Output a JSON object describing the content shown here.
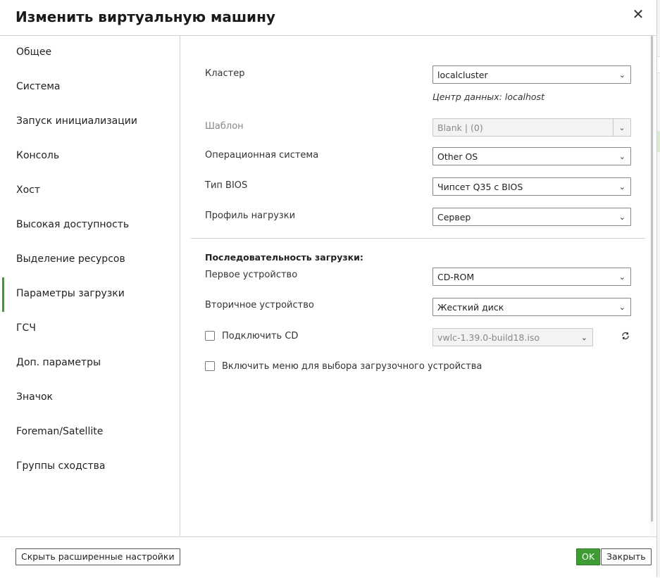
{
  "dialog": {
    "title": "Изменить виртуальную машину"
  },
  "sidebar": {
    "items": [
      {
        "label": "Общее"
      },
      {
        "label": "Система"
      },
      {
        "label": "Запуск инициализации"
      },
      {
        "label": "Консоль"
      },
      {
        "label": "Хост"
      },
      {
        "label": "Высокая доступность"
      },
      {
        "label": "Выделение ресурсов"
      },
      {
        "label": "Параметры загрузки",
        "active": true
      },
      {
        "label": "ГСЧ"
      },
      {
        "label": "Доп. параметры"
      },
      {
        "label": "Значок"
      },
      {
        "label": "Foreman/Satellite"
      },
      {
        "label": "Группы сходства"
      }
    ]
  },
  "form": {
    "cluster": {
      "label": "Кластер",
      "value": "localcluster",
      "note": "Центр данных: localhost"
    },
    "template": {
      "label": "Шаблон",
      "value": "Blank |  (0)"
    },
    "os": {
      "label": "Операционная система",
      "value": "Other OS"
    },
    "bios": {
      "label": "Тип BIOS",
      "value": "Чипсет Q35 с BIOS"
    },
    "profile": {
      "label": "Профиль нагрузки",
      "value": "Сервер"
    },
    "boot_sequence_title": "Последовательность загрузки:",
    "first_device": {
      "label": "Первое устройство",
      "value": "CD-ROM"
    },
    "second_device": {
      "label": "Вторичное устройство",
      "value": "Жесткий диск"
    },
    "attach_cd": {
      "label": "Подключить CD",
      "value": "vwlc-1.39.0-build18.iso",
      "checked": false
    },
    "boot_menu": {
      "label": "Включить меню для выбора загрузочного устройства",
      "checked": false
    }
  },
  "footer": {
    "advanced_label": "Скрыть расширенные настройки",
    "ok_label": "OK",
    "close_label": "Закрыть"
  },
  "colors": {
    "accent": "#3f9c35"
  },
  "icons": {
    "close": "close-icon",
    "chevron": "chevron-down-icon",
    "refresh": "refresh-icon"
  }
}
